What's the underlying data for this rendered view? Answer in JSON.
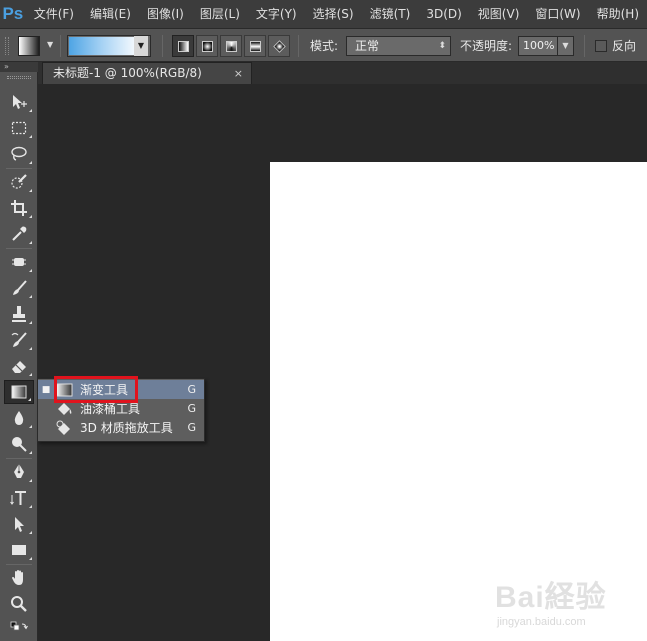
{
  "app": {
    "logo": "Ps"
  },
  "menu": [
    "文件(F)",
    "编辑(E)",
    "图像(I)",
    "图层(L)",
    "文字(Y)",
    "选择(S)",
    "滤镜(T)",
    "3D(D)",
    "视图(V)",
    "窗口(W)",
    "帮助(H)"
  ],
  "options": {
    "mode_label": "模式:",
    "mode_value": "正常",
    "opacity_label": "不透明度:",
    "opacity_value": "100%",
    "reverse_label": "反向",
    "reverse_checked": false,
    "gradient_colors": [
      "#4ea4e4",
      "#a6d2f4",
      "#f4f9fe"
    ],
    "gradient_types": [
      "linear-gradient-icon",
      "radial-gradient-icon",
      "angle-gradient-icon",
      "reflected-gradient-icon",
      "diamond-gradient-icon"
    ],
    "active_gradient_type": "linear"
  },
  "document": {
    "tab_title": "未标题-1 @ 100%(RGB/8)",
    "close_glyph": "×"
  },
  "toolbox": {
    "collapse_glyph": "»",
    "active_tool": "gradient-tool",
    "tools": [
      "move-tool",
      "marquee-tool",
      "lasso-tool",
      "quick-selection-tool",
      "crop-tool",
      "eyedropper-tool",
      "healing-brush-tool",
      "brush-tool",
      "clone-stamp-tool",
      "history-brush-tool",
      "eraser-tool",
      "gradient-tool",
      "blur-tool",
      "dodge-tool",
      "pen-tool",
      "type-tool",
      "path-selection-tool",
      "rectangle-tool",
      "hand-tool",
      "zoom-tool"
    ]
  },
  "flyout": {
    "items": [
      {
        "label": "渐变工具",
        "shortcut": "G",
        "selected": true
      },
      {
        "label": "油漆桶工具",
        "shortcut": "G",
        "selected": false
      },
      {
        "label": "3D 材质拖放工具",
        "shortcut": "G",
        "selected": false
      }
    ]
  },
  "watermark": {
    "text": "Bai経验",
    "url": "jingyan.baidu.com"
  }
}
